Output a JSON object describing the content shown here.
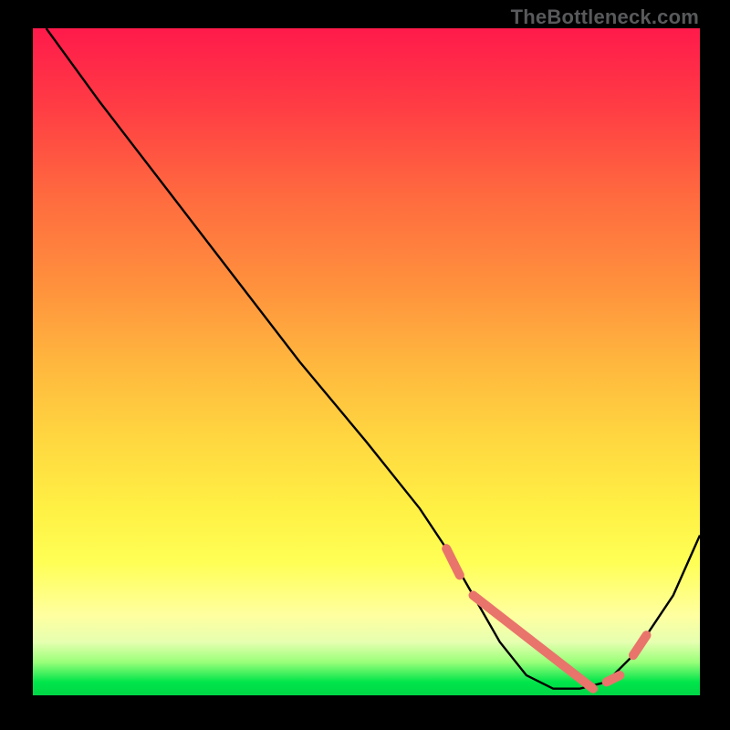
{
  "attribution": "TheBottleneck.com",
  "chart_data": {
    "type": "line",
    "title": "",
    "xlabel": "",
    "ylabel": "",
    "xlim": [
      0,
      100
    ],
    "ylim": [
      0,
      100
    ],
    "grid": false,
    "legend": false,
    "series": [
      {
        "name": "curve",
        "x": [
          2,
          10,
          20,
          30,
          40,
          50,
          58,
          62,
          66,
          70,
          74,
          78,
          82,
          86,
          90,
          96,
          100
        ],
        "y": [
          100,
          89,
          76,
          63,
          50,
          38,
          28,
          22,
          15,
          8,
          3,
          1,
          1,
          2,
          6,
          15,
          24
        ]
      }
    ],
    "highlight_segments": [
      {
        "x": [
          62,
          64
        ],
        "y": [
          22,
          18
        ]
      },
      {
        "x": [
          66,
          84
        ],
        "y": [
          15,
          1
        ]
      },
      {
        "x": [
          86,
          88
        ],
        "y": [
          2,
          3
        ]
      },
      {
        "x": [
          90,
          92
        ],
        "y": [
          6,
          9
        ]
      }
    ],
    "stroke_color": "#000000",
    "highlight_color": "#e9746b"
  }
}
